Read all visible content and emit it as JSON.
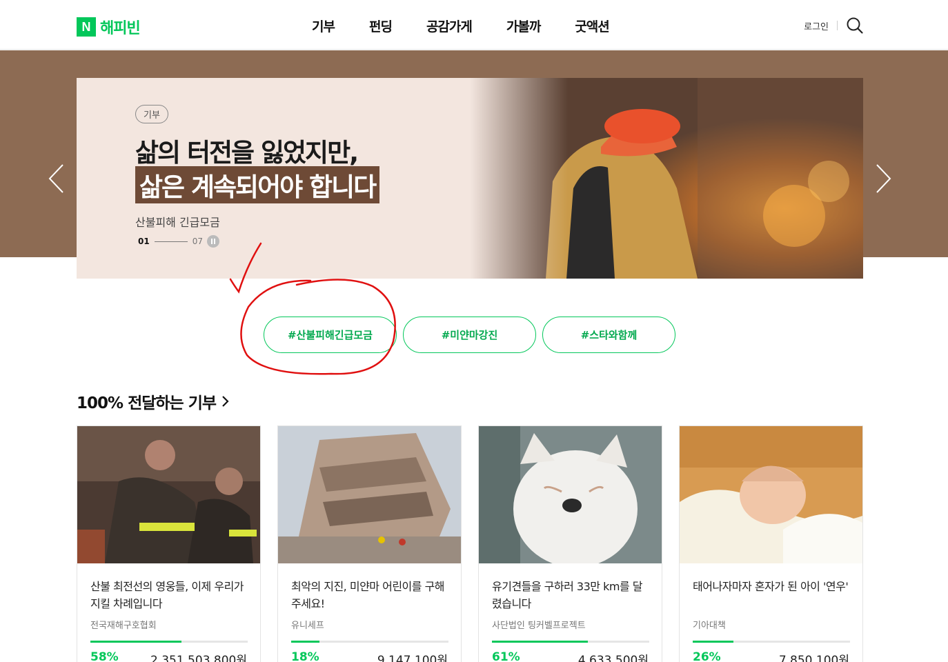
{
  "header": {
    "logo_mark": "N",
    "logo_text": "해피빈",
    "nav": [
      "기부",
      "펀딩",
      "공감가게",
      "가볼까",
      "굿액션"
    ],
    "login": "로그인"
  },
  "hero": {
    "badge": "기부",
    "title_line1": "삶의 터전을 잃었지만,",
    "title_line2": "삶은 계속되어야 합니다",
    "subtitle": "산불피해 긴급모금",
    "pager_current": "01",
    "pager_total": "07",
    "colors": {
      "band": "#8d6b53",
      "panel": "#f3e6df",
      "highlight": "#6e4a36"
    }
  },
  "tags": [
    "#산불피해긴급모금",
    "#미얀마강진",
    "#스타와함께"
  ],
  "section": {
    "title": "100% 전달하는 기부"
  },
  "cards": [
    {
      "title": "산불 최전선의 영웅들, 이제 우리가 지킬 차례입니다",
      "org": "전국재해구호협회",
      "rate": "58%",
      "amount": "2,351,503,800원",
      "progress": 0.58,
      "image": "firefighters-resting"
    },
    {
      "title": "최악의 지진, 미얀마 어린이를 구해주세요!",
      "org": "유니세프",
      "rate": "18%",
      "amount": "9,147,100원",
      "progress": 0.18,
      "image": "collapsed-building"
    },
    {
      "title": "유기견들을 구하러 33만 km를 달렸습니다",
      "org": "사단법인 팅커벨프로젝트",
      "rate": "61%",
      "amount": "4,633,500원",
      "progress": 0.61,
      "image": "white-dog"
    },
    {
      "title": "태어나자마자 혼자가 된 아이 '연우'",
      "org": "기아대책",
      "rate": "26%",
      "amount": "7,850,100원",
      "progress": 0.26,
      "image": "sleeping-baby"
    }
  ],
  "accent": "#03c75a"
}
